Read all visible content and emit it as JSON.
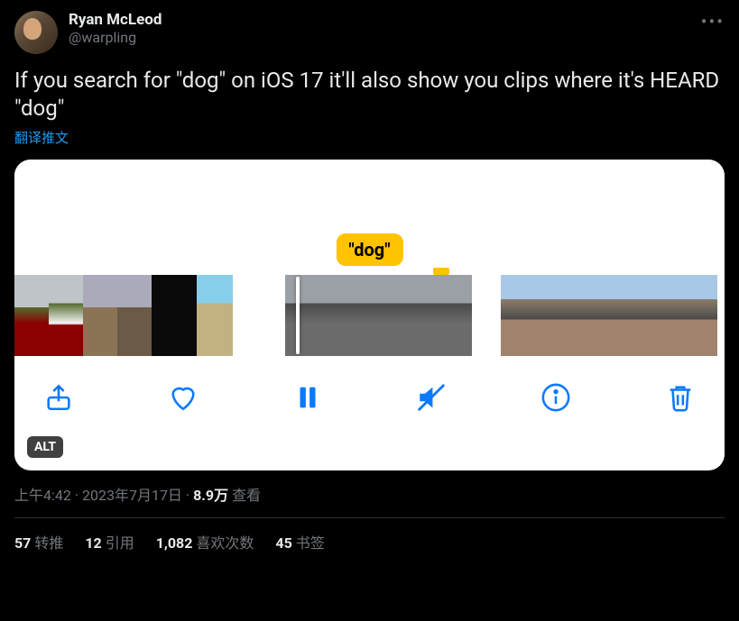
{
  "author": {
    "display_name": "Ryan McLeod",
    "handle": "@warpling"
  },
  "tweet_text": "If you search for \"dog\" on iOS 17 it'll also show you clips where it's HEARD \"dog\"",
  "translate_label": "翻译推文",
  "media": {
    "search_label": "\"dog\"",
    "alt_badge": "ALT"
  },
  "meta": {
    "time": "上午4:42",
    "date": "2023年7月17日",
    "views_count": "8.9万",
    "views_label": "查看"
  },
  "stats": {
    "retweets": {
      "count": "57",
      "label": "转推"
    },
    "quotes": {
      "count": "12",
      "label": "引用"
    },
    "likes": {
      "count": "1,082",
      "label": "喜欢次数"
    },
    "bookmarks": {
      "count": "45",
      "label": "书签"
    }
  }
}
